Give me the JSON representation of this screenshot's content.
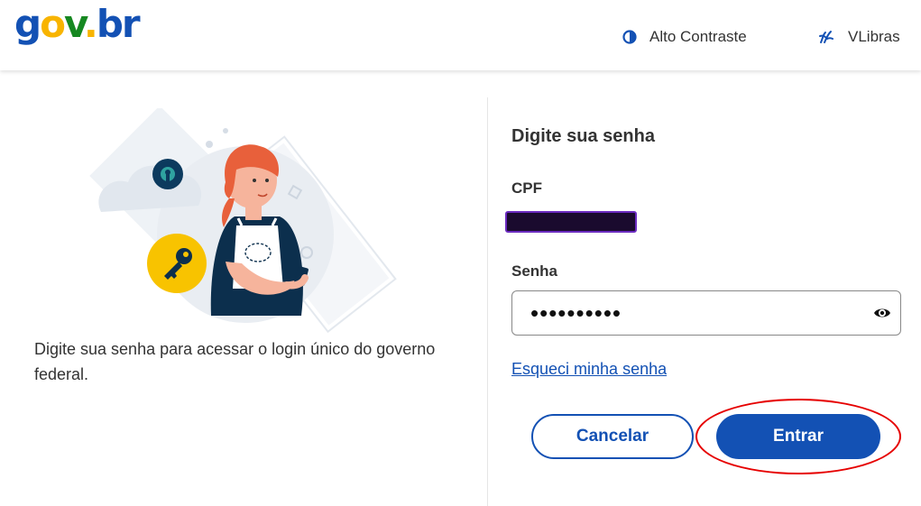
{
  "header": {
    "logo": {
      "g": "g",
      "o": "o",
      "v": "v",
      "dot": ".",
      "br": "br"
    },
    "contrast_label": "Alto Contraste",
    "vlibras_label": "VLibras"
  },
  "intro_text": "Digite sua senha para acessar o login único do governo federal.",
  "form": {
    "title": "Digite sua senha",
    "cpf_label": "CPF",
    "password_label": "Senha",
    "password_value": "••••••••••",
    "forgot_link": "Esqueci minha senha",
    "cancel_label": "Cancelar",
    "enter_label": "Entrar"
  },
  "icons": {
    "contrast": "contrast-icon",
    "vlibras": "vlibras-hands-icon",
    "eye": "eye-icon"
  },
  "colors": {
    "primary": "#1351b4",
    "logo_yellow": "#f8b400",
    "logo_green": "#168821",
    "highlight": "#e60000"
  }
}
